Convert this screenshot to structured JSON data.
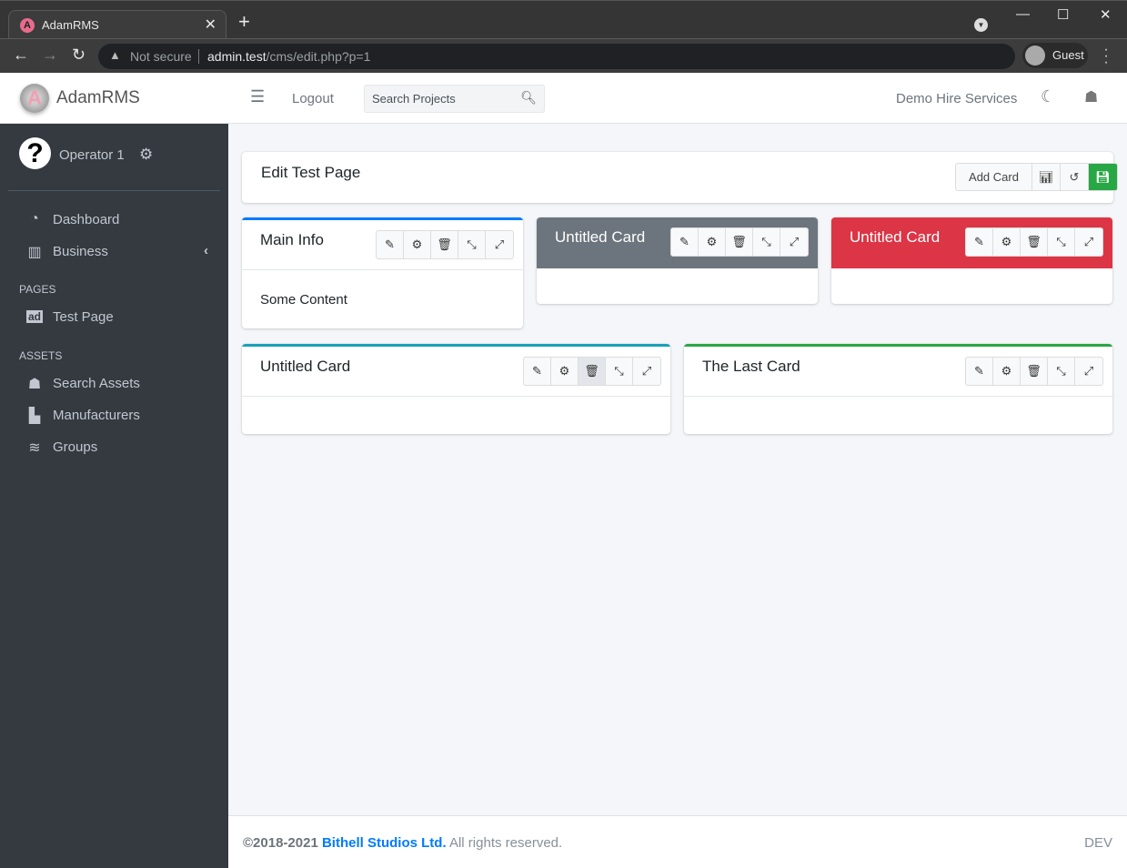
{
  "browser": {
    "tab_title": "AdamRMS",
    "tab_favicon": "A",
    "security_label": "Not secure",
    "url_host": "admin.test",
    "url_path": "/cms/edit.php?p=1",
    "profile_label": "Guest"
  },
  "sidebar": {
    "brand": "AdamRMS",
    "user_name": "Operator 1",
    "items": [
      {
        "label": "Dashboard",
        "icon": "tachometer-icon"
      },
      {
        "label": "Business",
        "icon": "building-icon"
      }
    ],
    "pages_header": "PAGES",
    "pages": [
      {
        "label": "Test Page",
        "icon": "ad-icon"
      }
    ],
    "assets_header": "ASSETS",
    "assets": [
      {
        "label": "Search Assets",
        "icon": "warehouse-icon"
      },
      {
        "label": "Manufacturers",
        "icon": "industry-icon"
      },
      {
        "label": "Groups",
        "icon": "layer-group-icon"
      }
    ]
  },
  "topnav": {
    "logout": "Logout",
    "search_placeholder": "Search Projects",
    "organisation": "Demo Hire Services"
  },
  "page": {
    "title": "Edit Test Page",
    "add_card": "Add Card"
  },
  "cards": [
    {
      "title": "Main Info",
      "body": "Some Content",
      "style": "outline",
      "color": "#007bff"
    },
    {
      "title": "Untitled Card",
      "body": "",
      "style": "filled",
      "color": "#6c757d"
    },
    {
      "title": "Untitled Card",
      "body": "",
      "style": "filled",
      "color": "#dc3545"
    },
    {
      "title": "Untitled Card",
      "body": "",
      "style": "outline",
      "color": "#17a2b8"
    },
    {
      "title": "The Last Card",
      "body": "",
      "style": "outline",
      "color": "#28a745"
    }
  ],
  "footer": {
    "years": "©2018-2021",
    "company": "Bithell Studios Ltd.",
    "rights": "All rights reserved.",
    "env": "DEV"
  }
}
